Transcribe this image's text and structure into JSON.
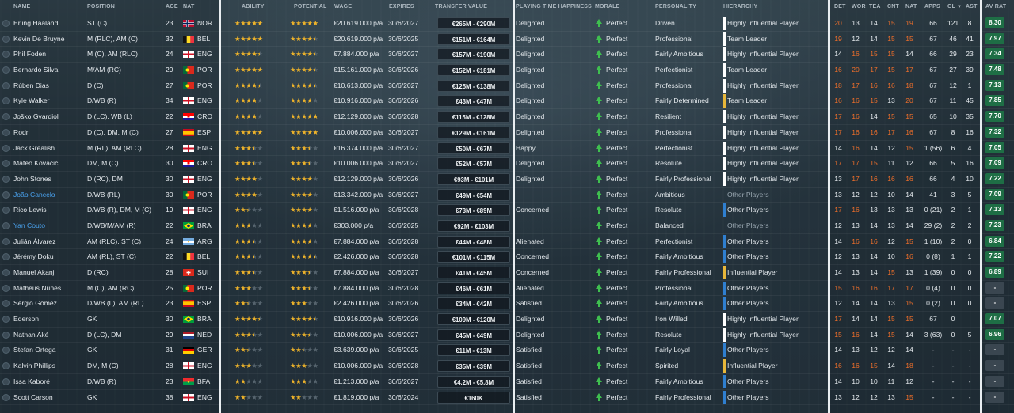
{
  "columns": {
    "name": "NAME",
    "position": "POSITION",
    "age": "AGE",
    "nat": "NAT",
    "ability": "ABILITY",
    "potential": "POTENTIAL",
    "wage": "WAGE",
    "expires": "EXPIRES",
    "transfer_value": "TRANSFER VALUE",
    "playing_time_happiness": "PLAYING TIME HAPPINESS",
    "morale": "MORALE",
    "personality": "PERSONALITY",
    "hierarchy": "HIERARCHY",
    "det": "DET",
    "wor": "WOR",
    "tea": "TEA",
    "cnt": "CNT",
    "nat2": "NAT",
    "apps": "APPS",
    "gl": "GL",
    "ast": "AST",
    "av_rat": "AV RAT"
  },
  "colors": {
    "accent": "#4aa3f0",
    "star": "#f0b42a",
    "orange": "#f06f2a",
    "green_rating": "#1e6e45",
    "morale": "#3fbf4f",
    "hier_white": "#ffffff",
    "hier_yellow": "#e8b73a",
    "hier_blue": "#2f7fd0"
  },
  "players": [
    {
      "name": "Erling Haaland",
      "position": "ST (C)",
      "age": "23",
      "nat": "NOR",
      "flag": "nor",
      "ability": 5,
      "potential": 5,
      "wage": "€20.619.000 p/a",
      "expires": "30/6/2027",
      "tv": "€265M - €290M",
      "pth": "Delighted",
      "morale": "Perfect",
      "personality": "Driven",
      "hierarchy": "Highly Influential Player",
      "hcolor": "white",
      "det": "20",
      "wor": "13",
      "tea": "14",
      "cnt": "15",
      "nat2": "19",
      "apps": "66",
      "gl": "121",
      "ast": "8",
      "rat": "8.30"
    },
    {
      "name": "Kevin De Bruyne",
      "position": "M (RLC), AM (C)",
      "age": "32",
      "nat": "BEL",
      "flag": "bel",
      "ability": 5,
      "potential": 4.5,
      "wage": "€20.619.000 p/a",
      "expires": "30/6/2025",
      "tv": "€151M - €164M",
      "pth": "Delighted",
      "morale": "Perfect",
      "personality": "Professional",
      "hierarchy": "Team Leader",
      "hcolor": "white",
      "det": "19",
      "wor": "12",
      "tea": "14",
      "cnt": "15",
      "nat2": "15",
      "apps": "67",
      "gl": "46",
      "ast": "41",
      "rat": "7.97"
    },
    {
      "name": "Phil Foden",
      "position": "M (C), AM (RLC)",
      "age": "24",
      "nat": "ENG",
      "flag": "eng",
      "ability": 4.5,
      "potential": 4.5,
      "wage": "€7.884.000 p/a",
      "expires": "30/6/2027",
      "tv": "€157M - €190M",
      "pth": "Delighted",
      "morale": "Perfect",
      "personality": "Fairly Ambitious",
      "hierarchy": "Highly Influential Player",
      "hcolor": "white",
      "det": "14",
      "wor": "16",
      "tea": "15",
      "cnt": "15",
      "nat2": "14",
      "apps": "66",
      "gl": "29",
      "ast": "23",
      "rat": "7.34"
    },
    {
      "name": "Bernardo Silva",
      "position": "M/AM (RC)",
      "age": "29",
      "nat": "POR",
      "flag": "por",
      "ability": 5,
      "potential": 4.5,
      "wage": "€15.161.000 p/a",
      "expires": "30/6/2026",
      "tv": "€152M - €181M",
      "pth": "Delighted",
      "morale": "Perfect",
      "personality": "Perfectionist",
      "hierarchy": "Team Leader",
      "hcolor": "white",
      "det": "16",
      "wor": "20",
      "tea": "17",
      "cnt": "15",
      "nat2": "17",
      "apps": "67",
      "gl": "27",
      "ast": "39",
      "rat": "7.48"
    },
    {
      "name": "Rúben Dias",
      "position": "D (C)",
      "age": "27",
      "nat": "POR",
      "flag": "por",
      "ability": 4.5,
      "potential": 4.5,
      "wage": "€10.613.000 p/a",
      "expires": "30/6/2027",
      "tv": "€125M - €138M",
      "pth": "Delighted",
      "morale": "Perfect",
      "personality": "Professional",
      "hierarchy": "Highly Influential Player",
      "hcolor": "white",
      "det": "18",
      "wor": "17",
      "tea": "16",
      "cnt": "16",
      "nat2": "18",
      "apps": "67",
      "gl": "12",
      "ast": "1",
      "rat": "7.13"
    },
    {
      "name": "Kyle Walker",
      "position": "D/WB (R)",
      "age": "34",
      "nat": "ENG",
      "flag": "eng",
      "ability": 4,
      "potential": 4,
      "wage": "€10.916.000 p/a",
      "expires": "30/6/2026",
      "tv": "€43M - €47M",
      "pth": "Delighted",
      "morale": "Perfect",
      "personality": "Fairly Determined",
      "hierarchy": "Team Leader",
      "hcolor": "yellow",
      "det": "16",
      "wor": "16",
      "tea": "15",
      "cnt": "13",
      "nat2": "20",
      "apps": "67",
      "gl": "11",
      "ast": "45",
      "rat": "7.85"
    },
    {
      "name": "Joško Gvardiol",
      "position": "D (LC), WB (L)",
      "age": "22",
      "nat": "CRO",
      "flag": "cro",
      "ability": 4,
      "potential": 5,
      "wage": "€12.129.000 p/a",
      "expires": "30/6/2028",
      "tv": "€115M - €128M",
      "pth": "Delighted",
      "morale": "Perfect",
      "personality": "Resilient",
      "hierarchy": "Highly Influential Player",
      "hcolor": "white",
      "det": "17",
      "wor": "16",
      "tea": "14",
      "cnt": "15",
      "nat2": "15",
      "apps": "65",
      "gl": "10",
      "ast": "35",
      "rat": "7.70"
    },
    {
      "name": "Rodri",
      "position": "D (C), DM, M (C)",
      "age": "27",
      "nat": "ESP",
      "flag": "esp",
      "ability": 5,
      "potential": 5,
      "wage": "€10.006.000 p/a",
      "expires": "30/6/2027",
      "tv": "€129M - €161M",
      "pth": "Delighted",
      "morale": "Perfect",
      "personality": "Professional",
      "hierarchy": "Highly Influential Player",
      "hcolor": "white",
      "det": "17",
      "wor": "16",
      "tea": "16",
      "cnt": "17",
      "nat2": "16",
      "apps": "67",
      "gl": "8",
      "ast": "16",
      "rat": "7.32"
    },
    {
      "name": "Jack Grealish",
      "position": "M (RL), AM (RLC)",
      "age": "28",
      "nat": "ENG",
      "flag": "eng",
      "ability": 3.5,
      "potential": 3.5,
      "wage": "€16.374.000 p/a",
      "expires": "30/6/2027",
      "tv": "€50M - €67M",
      "pth": "Happy",
      "morale": "Perfect",
      "personality": "Perfectionist",
      "hierarchy": "Highly Influential Player",
      "hcolor": "white",
      "det": "14",
      "wor": "16",
      "tea": "14",
      "cnt": "12",
      "nat2": "15",
      "apps": "1 (56)",
      "gl": "6",
      "ast": "4",
      "rat": "7.05"
    },
    {
      "name": "Mateo Kovačić",
      "position": "DM, M (C)",
      "age": "30",
      "nat": "CRO",
      "flag": "cro",
      "ability": 3.5,
      "potential": 3.5,
      "wage": "€10.006.000 p/a",
      "expires": "30/6/2027",
      "tv": "€52M - €57M",
      "pth": "Delighted",
      "morale": "Perfect",
      "personality": "Resolute",
      "hierarchy": "Highly Influential Player",
      "hcolor": "white",
      "det": "17",
      "wor": "17",
      "tea": "15",
      "cnt": "11",
      "nat2": "12",
      "apps": "66",
      "gl": "5",
      "ast": "16",
      "rat": "7.09"
    },
    {
      "name": "John Stones",
      "position": "D (RC), DM",
      "age": "30",
      "nat": "ENG",
      "flag": "eng",
      "ability": 4,
      "potential": 4,
      "wage": "€12.129.000 p/a",
      "expires": "30/6/2026",
      "tv": "€93M - €101M",
      "pth": "Delighted",
      "morale": "Perfect",
      "personality": "Fairly Professional",
      "hierarchy": "Highly Influential Player",
      "hcolor": "white",
      "det": "13",
      "wor": "17",
      "tea": "16",
      "cnt": "16",
      "nat2": "16",
      "apps": "66",
      "gl": "4",
      "ast": "10",
      "rat": "7.22"
    },
    {
      "name": "João Cancelo",
      "position": "D/WB (RL)",
      "age": "30",
      "nat": "POR",
      "flag": "por",
      "link": true,
      "ability": 4,
      "potential": 4,
      "wage": "€13.342.000 p/a",
      "expires": "30/6/2027",
      "tv": "€49M - €54M",
      "pth": "",
      "morale": "Perfect",
      "personality": "Ambitious",
      "hierarchy": "Other Players",
      "hcolor": "none",
      "det": "13",
      "wor": "12",
      "tea": "12",
      "cnt": "10",
      "nat2": "14",
      "apps": "41",
      "gl": "3",
      "ast": "5",
      "rat": "7.09"
    },
    {
      "name": "Rico Lewis",
      "position": "D/WB (R), DM, M (C)",
      "age": "19",
      "nat": "ENG",
      "flag": "eng",
      "ability": 2.5,
      "potential": 4,
      "wage": "€1.516.000 p/a",
      "expires": "30/6/2028",
      "tv": "€73M - €89M",
      "pth": "Concerned",
      "morale": "Perfect",
      "personality": "Resolute",
      "hierarchy": "Other Players",
      "hcolor": "blue",
      "det": "17",
      "wor": "16",
      "tea": "13",
      "cnt": "13",
      "nat2": "13",
      "apps": "0 (21)",
      "gl": "2",
      "ast": "1",
      "rat": "7.13"
    },
    {
      "name": "Yan Couto",
      "position": "D/WB/M/AM (R)",
      "age": "22",
      "nat": "BRA",
      "flag": "bra",
      "link": true,
      "ability": 3,
      "potential": 4,
      "wage": "€303.000 p/a",
      "expires": "30/6/2025",
      "tv": "€92M - €103M",
      "pth": "",
      "morale": "Perfect",
      "personality": "Balanced",
      "hierarchy": "Other Players",
      "hcolor": "none",
      "det": "12",
      "wor": "13",
      "tea": "14",
      "cnt": "13",
      "nat2": "14",
      "apps": "29 (2)",
      "gl": "2",
      "ast": "2",
      "rat": "7.23"
    },
    {
      "name": "Julián Álvarez",
      "position": "AM (RLC), ST (C)",
      "age": "24",
      "nat": "ARG",
      "flag": "arg",
      "ability": 3.5,
      "potential": 4,
      "wage": "€7.884.000 p/a",
      "expires": "30/6/2028",
      "tv": "€44M - €48M",
      "pth": "Alienated",
      "morale": "Perfect",
      "personality": "Perfectionist",
      "hierarchy": "Other Players",
      "hcolor": "blue",
      "det": "14",
      "wor": "16",
      "tea": "16",
      "cnt": "12",
      "nat2": "15",
      "apps": "1 (10)",
      "gl": "2",
      "ast": "0",
      "rat": "6.84"
    },
    {
      "name": "Jérémy Doku",
      "position": "AM (RL), ST (C)",
      "age": "22",
      "nat": "BEL",
      "flag": "bel",
      "ability": 3.5,
      "potential": 4.5,
      "wage": "€2.426.000 p/a",
      "expires": "30/6/2028",
      "tv": "€101M - €115M",
      "pth": "Concerned",
      "morale": "Perfect",
      "personality": "Fairly Ambitious",
      "hierarchy": "Other Players",
      "hcolor": "blue",
      "det": "12",
      "wor": "13",
      "tea": "14",
      "cnt": "10",
      "nat2": "16",
      "apps": "0 (8)",
      "gl": "1",
      "ast": "1",
      "rat": "7.22"
    },
    {
      "name": "Manuel Akanji",
      "position": "D (RC)",
      "age": "28",
      "nat": "SUI",
      "flag": "sui",
      "ability": 3.5,
      "potential": 3.5,
      "wage": "€7.884.000 p/a",
      "expires": "30/6/2027",
      "tv": "€41M - €45M",
      "pth": "Concerned",
      "morale": "Perfect",
      "personality": "Fairly Professional",
      "hierarchy": "Influential Player",
      "hcolor": "yellow",
      "det": "14",
      "wor": "13",
      "tea": "14",
      "cnt": "15",
      "nat2": "13",
      "apps": "1 (39)",
      "gl": "0",
      "ast": "0",
      "rat": "6.89"
    },
    {
      "name": "Matheus Nunes",
      "position": "M (C), AM (RC)",
      "age": "25",
      "nat": "POR",
      "flag": "por",
      "ability": 3,
      "potential": 3.5,
      "wage": "€7.884.000 p/a",
      "expires": "30/6/2028",
      "tv": "€46M - €61M",
      "pth": "Alienated",
      "morale": "Perfect",
      "personality": "Professional",
      "hierarchy": "Other Players",
      "hcolor": "blue",
      "det": "15",
      "wor": "16",
      "tea": "16",
      "cnt": "17",
      "nat2": "17",
      "apps": "0 (4)",
      "gl": "0",
      "ast": "0",
      "rat": "-"
    },
    {
      "name": "Sergio Gómez",
      "position": "D/WB (L), AM (RL)",
      "age": "23",
      "nat": "ESP",
      "flag": "esp",
      "ability": 2.5,
      "potential": 3,
      "wage": "€2.426.000 p/a",
      "expires": "30/6/2026",
      "tv": "€34M - €42M",
      "pth": "Satisfied",
      "morale": "Perfect",
      "personality": "Fairly Ambitious",
      "hierarchy": "Other Players",
      "hcolor": "blue",
      "det": "12",
      "wor": "14",
      "tea": "14",
      "cnt": "13",
      "nat2": "15",
      "apps": "0 (2)",
      "gl": "0",
      "ast": "0",
      "rat": "-"
    },
    {
      "name": "Ederson",
      "position": "GK",
      "age": "30",
      "nat": "BRA",
      "flag": "bra",
      "ability": 4.5,
      "potential": 4.5,
      "wage": "€10.916.000 p/a",
      "expires": "30/6/2026",
      "tv": "€109M - €120M",
      "pth": "Delighted",
      "morale": "Perfect",
      "personality": "Iron Willed",
      "hierarchy": "Highly Influential Player",
      "hcolor": "white",
      "det": "17",
      "wor": "14",
      "tea": "14",
      "cnt": "15",
      "nat2": "15",
      "apps": "67",
      "gl": "0",
      "ast": "",
      "rat": "7.07"
    },
    {
      "name": "Nathan Aké",
      "position": "D (LC), DM",
      "age": "29",
      "nat": "NED",
      "flag": "ned",
      "ability": 3.5,
      "potential": 3.5,
      "wage": "€10.006.000 p/a",
      "expires": "30/6/2027",
      "tv": "€45M - €49M",
      "pth": "Delighted",
      "morale": "Perfect",
      "personality": "Resolute",
      "hierarchy": "Highly Influential Player",
      "hcolor": "white",
      "det": "15",
      "wor": "16",
      "tea": "14",
      "cnt": "15",
      "nat2": "14",
      "apps": "3 (63)",
      "gl": "0",
      "ast": "5",
      "rat": "6.96"
    },
    {
      "name": "Stefan Ortega",
      "position": "GK",
      "age": "31",
      "nat": "GER",
      "flag": "ger",
      "ability": 2.5,
      "potential": 2.5,
      "wage": "€3.639.000 p/a",
      "expires": "30/6/2025",
      "tv": "€11M - €13M",
      "pth": "Satisfied",
      "morale": "Perfect",
      "personality": "Fairly Loyal",
      "hierarchy": "Other Players",
      "hcolor": "blue",
      "det": "14",
      "wor": "13",
      "tea": "12",
      "cnt": "12",
      "nat2": "14",
      "apps": "-",
      "gl": "-",
      "ast": "-",
      "rat": "-"
    },
    {
      "name": "Kalvin Phillips",
      "position": "DM, M (C)",
      "age": "28",
      "nat": "ENG",
      "flag": "eng",
      "ability": 3,
      "potential": 3,
      "wage": "€10.006.000 p/a",
      "expires": "30/6/2028",
      "tv": "€35M - €39M",
      "pth": "Satisfied",
      "morale": "Perfect",
      "personality": "Spirited",
      "hierarchy": "Influential Player",
      "hcolor": "yellow",
      "det": "16",
      "wor": "16",
      "tea": "15",
      "cnt": "14",
      "nat2": "18",
      "apps": "-",
      "gl": "-",
      "ast": "-",
      "rat": "-"
    },
    {
      "name": "Issa Kaboré",
      "position": "D/WB (R)",
      "age": "23",
      "nat": "BFA",
      "flag": "bfa",
      "ability": 2,
      "potential": 3,
      "wage": "€1.213.000 p/a",
      "expires": "30/6/2027",
      "tv": "€4.2M - €5.8M",
      "pth": "Satisfied",
      "morale": "Perfect",
      "personality": "Fairly Ambitious",
      "hierarchy": "Other Players",
      "hcolor": "blue",
      "det": "14",
      "wor": "10",
      "tea": "10",
      "cnt": "11",
      "nat2": "12",
      "apps": "-",
      "gl": "-",
      "ast": "-",
      "rat": "-"
    },
    {
      "name": "Scott Carson",
      "position": "GK",
      "age": "38",
      "nat": "ENG",
      "flag": "eng",
      "ability": 2,
      "potential": 2,
      "wage": "€1.819.000 p/a",
      "expires": "30/6/2024",
      "tv": "€160K",
      "pth": "Satisfied",
      "morale": "Perfect",
      "personality": "Fairly Professional",
      "hierarchy": "Other Players",
      "hcolor": "blue",
      "det": "13",
      "wor": "12",
      "tea": "12",
      "cnt": "13",
      "nat2": "15",
      "apps": "-",
      "gl": "-",
      "ast": "-",
      "rat": "-"
    }
  ]
}
